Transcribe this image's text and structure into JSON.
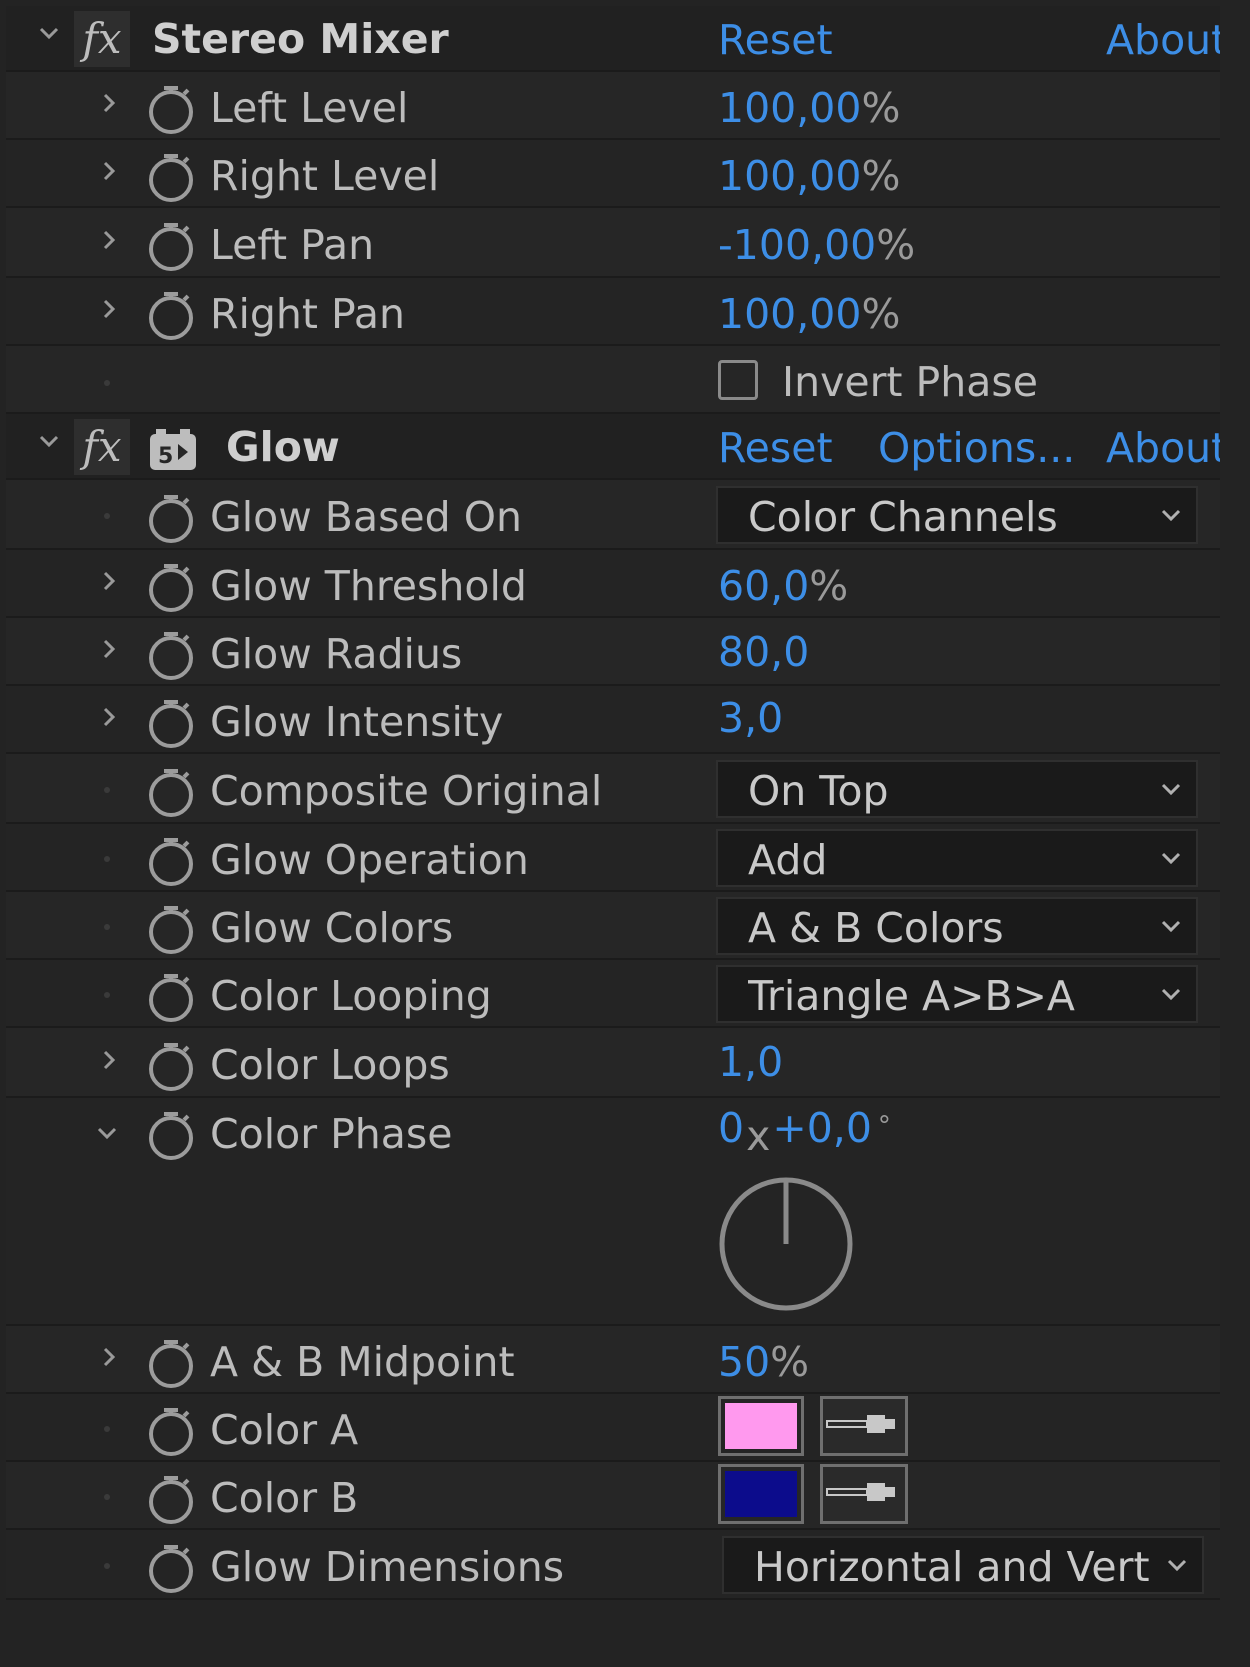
{
  "effects": [
    {
      "name": "Stereo Mixer",
      "reset_label": "Reset",
      "about_label": "About",
      "properties": [
        {
          "label": "Left Level",
          "value": "100,00",
          "unit": "%"
        },
        {
          "label": "Right Level",
          "value": "100,00",
          "unit": "%"
        },
        {
          "label": "Left Pan",
          "value": "-100,00",
          "unit": "%"
        },
        {
          "label": "Right Pan",
          "value": "100,00",
          "unit": "%"
        }
      ],
      "checkbox": {
        "label": "Invert Phase",
        "checked": false
      }
    },
    {
      "name": "Glow",
      "reset_label": "Reset",
      "options_label": "Options...",
      "about_label": "About",
      "properties": {
        "glow_based_on": {
          "label": "Glow Based On",
          "selected": "Color Channels"
        },
        "glow_threshold": {
          "label": "Glow Threshold",
          "value": "60,0",
          "unit": "%"
        },
        "glow_radius": {
          "label": "Glow Radius",
          "value": "80,0"
        },
        "glow_intensity": {
          "label": "Glow Intensity",
          "value": "3,0"
        },
        "composite_original": {
          "label": "Composite Original",
          "selected": "On Top"
        },
        "glow_operation": {
          "label": "Glow Operation",
          "selected": "Add"
        },
        "glow_colors": {
          "label": "Glow Colors",
          "selected": "A & B Colors"
        },
        "color_looping": {
          "label": "Color Looping",
          "selected": "Triangle A>B>A"
        },
        "color_loops": {
          "label": "Color Loops",
          "value": "1,0"
        },
        "color_phase": {
          "label": "Color Phase",
          "revolutions": "0",
          "x_sep": "x",
          "degrees": "+0,0",
          "degree_sign": "°",
          "angle_deg": 0
        },
        "ab_midpoint": {
          "label": "A & B Midpoint",
          "value": "50",
          "unit": "%"
        },
        "color_a": {
          "label": "Color A",
          "color": "#ff99ee"
        },
        "color_b": {
          "label": "Color B",
          "color": "#0c0c8c"
        },
        "glow_dimensions": {
          "label": "Glow Dimensions",
          "selected": "Horizontal and Vert"
        }
      }
    }
  ],
  "theme": {
    "accent": "#3d8ee6",
    "background": "#232323"
  }
}
